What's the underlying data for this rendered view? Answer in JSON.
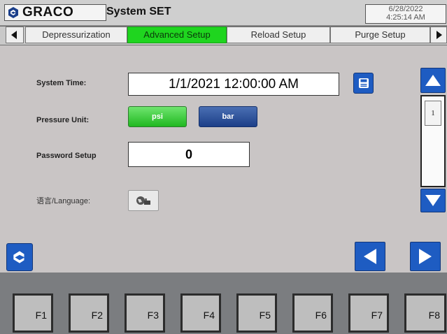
{
  "header": {
    "brand": "GRACO",
    "title": "System SET",
    "date": "6/28/2022",
    "time": "4:25:14 AM"
  },
  "tabs": [
    {
      "label": "Depressurization",
      "active": false
    },
    {
      "label": "Advanced Setup",
      "active": true
    },
    {
      "label": "Reload Setup",
      "active": false
    },
    {
      "label": "Purge Setup",
      "active": false
    }
  ],
  "settings": {
    "system_time_label": "System Time:",
    "system_time_value": "1/1/2021 12:00:00 AM",
    "pressure_unit_label": "Pressure Unit:",
    "unit_psi": "psi",
    "unit_bar": "bar",
    "password_label": "Password Setup",
    "password_value": "0",
    "language_label": "语言/Language:"
  },
  "scroll": {
    "page": "1"
  },
  "function_keys": [
    "F1",
    "F2",
    "F3",
    "F4",
    "F5",
    "F6",
    "F7",
    "F8"
  ],
  "colors": {
    "active_tab": "#1fd51f",
    "accent_blue": "#1e5cc2",
    "background": "#c9c5c5"
  },
  "icons": [
    "graco-logo-icon",
    "tab-left-arrow-icon",
    "tab-right-arrow-icon",
    "save-icon",
    "language-icon",
    "scroll-up-icon",
    "scroll-down-icon",
    "nav-left-icon",
    "nav-right-icon"
  ]
}
